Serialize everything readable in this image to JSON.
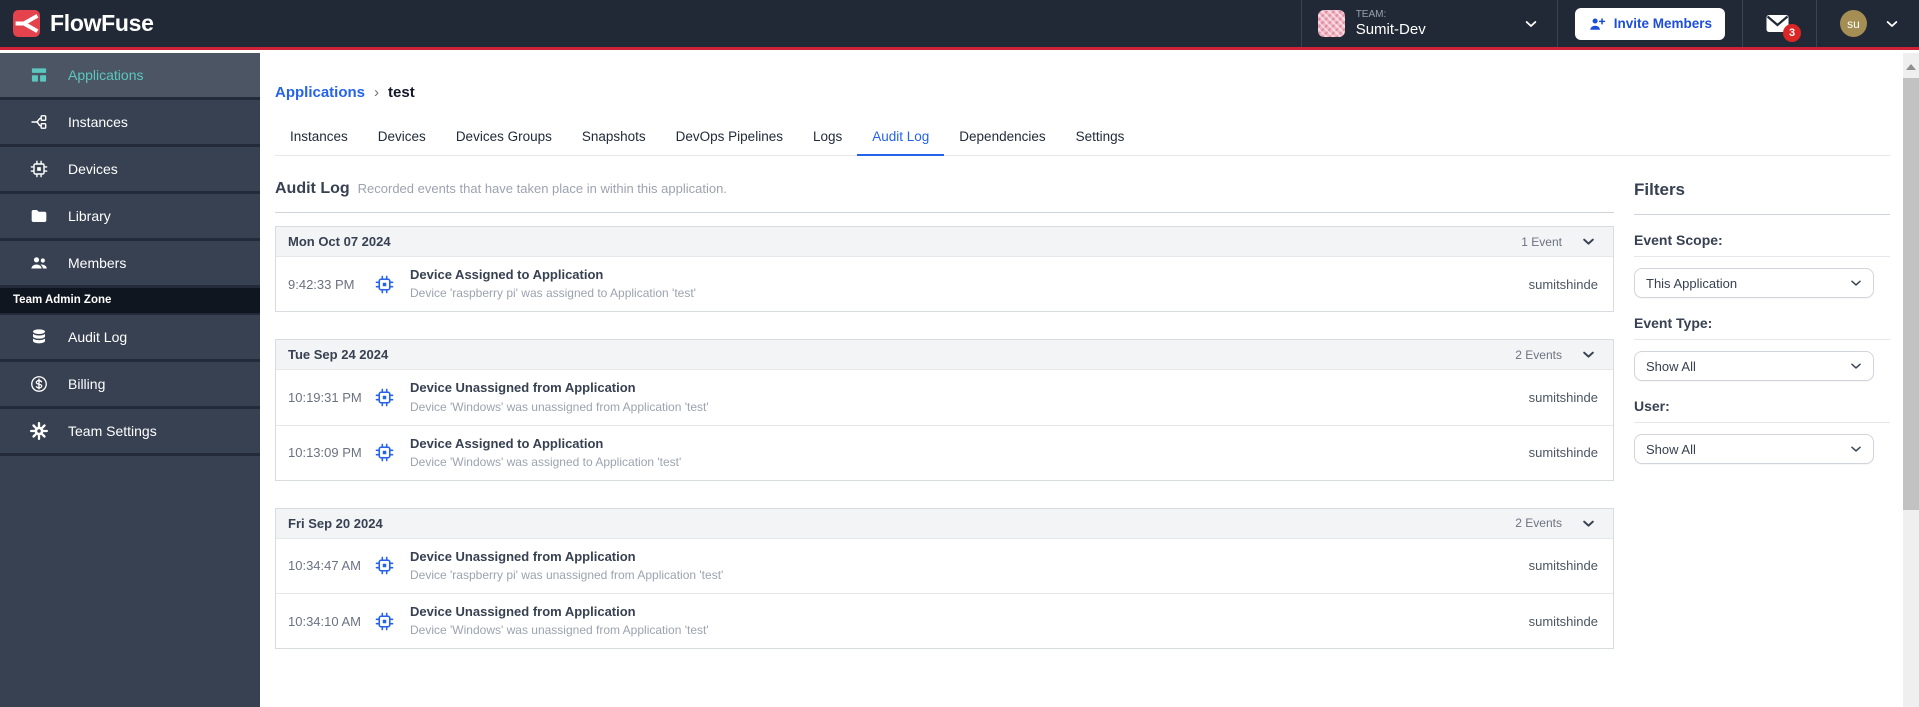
{
  "colors": {
    "topbar_bg": "#212936",
    "accent_red": "#cf2138",
    "logo_red": "#e4424d",
    "sidebar_bg": "#374151",
    "sidebar_active_bg": "#4b5563",
    "teal": "#5bc7bf",
    "link_blue": "#2563eb",
    "badge_red": "#dc2626",
    "avatar_khaki": "#a58e53",
    "group_header_bg": "#f3f4f6"
  },
  "navbar": {
    "logo_text": "FlowFuse",
    "team": {
      "label": "TEAM:",
      "name": "Sumit-Dev"
    },
    "invite_button_label": "Invite Members",
    "notifications_badge": "3",
    "user_initials": "su"
  },
  "sidebar": {
    "items": [
      {
        "label": "Applications",
        "icon": "applications-icon",
        "active": true
      },
      {
        "label": "Instances",
        "icon": "instances-icon"
      },
      {
        "label": "Devices",
        "icon": "devices-icon"
      },
      {
        "label": "Library",
        "icon": "library-icon"
      },
      {
        "label": "Members",
        "icon": "members-icon"
      }
    ],
    "section_label": "Team Admin Zone",
    "admin_items": [
      {
        "label": "Audit Log",
        "icon": "audit-log-icon"
      },
      {
        "label": "Billing",
        "icon": "billing-icon"
      },
      {
        "label": "Team Settings",
        "icon": "settings-icon"
      }
    ]
  },
  "breadcrumb": {
    "parent": "Applications",
    "separator": "›",
    "current": "test"
  },
  "tabs": [
    {
      "label": "Instances"
    },
    {
      "label": "Devices"
    },
    {
      "label": "Devices Groups"
    },
    {
      "label": "Snapshots"
    },
    {
      "label": "DevOps Pipelines"
    },
    {
      "label": "Logs"
    },
    {
      "label": "Audit Log",
      "active": true
    },
    {
      "label": "Dependencies"
    },
    {
      "label": "Settings"
    }
  ],
  "audit": {
    "title": "Audit Log",
    "subtitle": "Recorded events that have taken place in within this application.",
    "groups": [
      {
        "date": "Mon Oct 07 2024",
        "count_label": "1 Event",
        "events": [
          {
            "time": "9:42:33 PM",
            "title": "Device Assigned to Application",
            "description": "Device 'raspberry pi' was assigned to Application 'test'",
            "user": "sumitshinde"
          }
        ]
      },
      {
        "date": "Tue Sep 24 2024",
        "count_label": "2 Events",
        "events": [
          {
            "time": "10:19:31 PM",
            "title": "Device Unassigned from Application",
            "description": "Device 'Windows' was unassigned from Application 'test'",
            "user": "sumitshinde"
          },
          {
            "time": "10:13:09 PM",
            "title": "Device Assigned to Application",
            "description": "Device 'Windows' was assigned to Application 'test'",
            "user": "sumitshinde"
          }
        ]
      },
      {
        "date": "Fri Sep 20 2024",
        "count_label": "2 Events",
        "events": [
          {
            "time": "10:34:47 AM",
            "title": "Device Unassigned from Application",
            "description": "Device 'raspberry pi' was unassigned from Application 'test'",
            "user": "sumitshinde"
          },
          {
            "time": "10:34:10 AM",
            "title": "Device Unassigned from Application",
            "description": "Device 'Windows' was unassigned from Application 'test'",
            "user": "sumitshinde"
          }
        ]
      }
    ]
  },
  "filters": {
    "title": "Filters",
    "fields": [
      {
        "label": "Event Scope:",
        "value": "This Application"
      },
      {
        "label": "Event Type:",
        "value": "Show All"
      },
      {
        "label": "User:",
        "value": "Show All"
      }
    ]
  }
}
